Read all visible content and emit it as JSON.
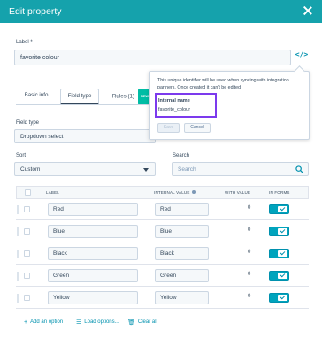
{
  "header": {
    "title": "Edit property"
  },
  "label_field": {
    "label": "Label *",
    "value": "favorite colour"
  },
  "tabs": [
    {
      "label": "Basic info"
    },
    {
      "label": "Field type"
    },
    {
      "label": "Rules (1)",
      "badge": "NEW"
    }
  ],
  "field_type": {
    "label": "Field type",
    "value": "Dropdown select"
  },
  "sort": {
    "label": "Sort",
    "value": "Custom"
  },
  "search": {
    "label": "Search",
    "placeholder": "Search"
  },
  "table": {
    "headers": {
      "label": "LABEL",
      "internal_value": "INTERNAL VALUE",
      "with_value": "WITH VALUE",
      "in_forms": "IN FORMS"
    },
    "rows": [
      {
        "label": "Red",
        "internal": "Red",
        "count": "0"
      },
      {
        "label": "Blue",
        "internal": "Blue",
        "count": "0"
      },
      {
        "label": "Black",
        "internal": "Black",
        "count": "0"
      },
      {
        "label": "Green",
        "internal": "Green",
        "count": "0"
      },
      {
        "label": "Yellow",
        "internal": "Yellow",
        "count": "0"
      }
    ]
  },
  "footer": {
    "add": "Add an option",
    "load": "Load options...",
    "clear": "Clear all"
  },
  "popover": {
    "text": "This unique identifier will be used when syncing with integration partners. Once created it can't be edited.",
    "internal_label": "Internal name",
    "internal_value": "favorite_colour",
    "save": "Save",
    "cancel": "Cancel"
  },
  "colors": {
    "header": "#15a2ac",
    "accent": "#0091ae",
    "highlight": "#7c3aed"
  }
}
